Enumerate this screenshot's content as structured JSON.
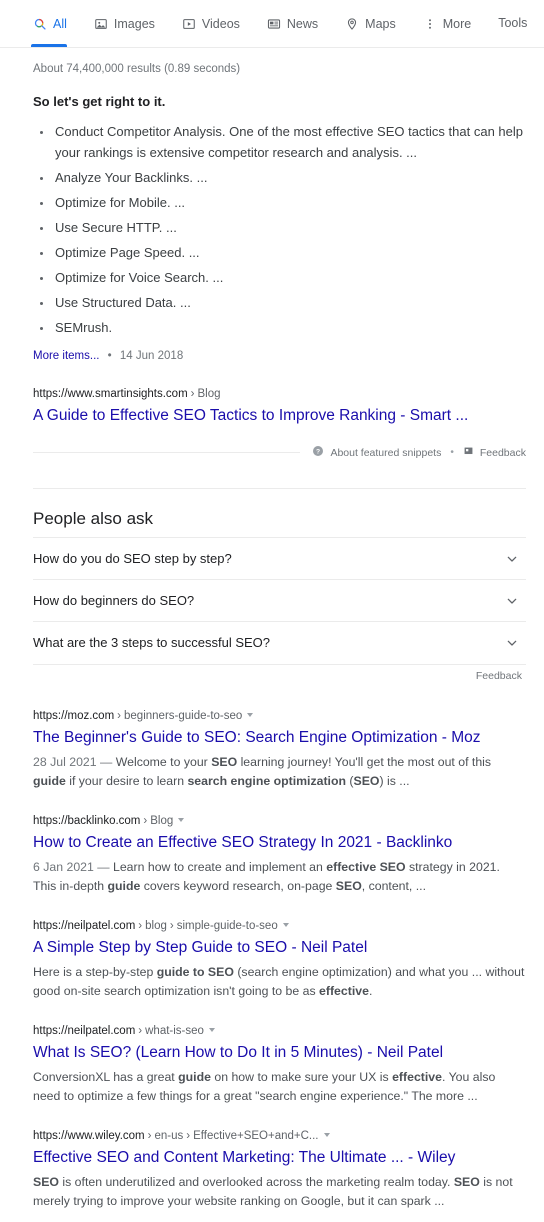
{
  "nav": {
    "items": [
      {
        "label": "All",
        "icon": "search-icon",
        "active": true
      },
      {
        "label": "Images",
        "icon": "image-icon",
        "active": false
      },
      {
        "label": "Videos",
        "icon": "video-icon",
        "active": false
      },
      {
        "label": "News",
        "icon": "news-icon",
        "active": false
      },
      {
        "label": "Maps",
        "icon": "map-pin-icon",
        "active": false
      },
      {
        "label": "More",
        "icon": "more-vertical-icon",
        "active": false
      }
    ],
    "tools_label": "Tools",
    "active_color": "#1a73e8",
    "inactive_color": "#5f6368"
  },
  "stats": "About 74,400,000 results (0.89 seconds)",
  "featured_snippet": {
    "heading": "So let's get right to it.",
    "bullets": [
      "Conduct Competitor Analysis. One of the most effective SEO tactics that can help your rankings is extensive competitor research and analysis. ...",
      "Analyze Your Backlinks. ...",
      "Optimize for Mobile. ...",
      "Use Secure HTTP. ...",
      "Optimize Page Speed. ...",
      "Optimize for Voice Search. ...",
      "Use Structured Data. ...",
      "SEMrush."
    ],
    "more_items_label": "More items...",
    "date": "14 Jun 2018",
    "source": {
      "domain": "https://www.smartinsights.com",
      "crumb": "Blog",
      "title": "A Guide to Effective SEO Tactics to Improve Ranking - Smart ..."
    },
    "footer": {
      "about_label": "About featured snippets",
      "about_icon": "help-circle-icon",
      "feedback_label": "Feedback",
      "feedback_icon": "flag-icon"
    }
  },
  "people_also_ask": {
    "title": "People also ask",
    "questions": [
      "How do you do SEO step by step?",
      "How do beginners do SEO?",
      "What are the 3 steps to successful SEO?"
    ],
    "expand_icon": "chevron-down-icon",
    "feedback_label": "Feedback"
  },
  "results": [
    {
      "domain": "https://moz.com",
      "crumbs": [
        "beginners-guide-to-seo"
      ],
      "title": "The Beginner's Guide to SEO: Search Engine Optimization - Moz",
      "date": "28 Jul 2021",
      "snippet_html": "Welcome to your <b>SEO</b> learning journey! You'll get the most out of this <b>guide</b> if your desire to learn <b>search engine optimization</b> (<b>SEO</b>) is ..."
    },
    {
      "domain": "https://backlinko.com",
      "crumbs": [
        "Blog"
      ],
      "title": "How to Create an Effective SEO Strategy In 2021 - Backlinko",
      "date": "6 Jan 2021",
      "snippet_html": "Learn how to create and implement an <b>effective SEO</b> strategy in 2021. This in-depth <b>guide</b> covers keyword research, on-page <b>SEO</b>, content, ..."
    },
    {
      "domain": "https://neilpatel.com",
      "crumbs": [
        "blog",
        "simple-guide-to-seo"
      ],
      "title": "A Simple Step by Step Guide to SEO - Neil Patel",
      "date": "",
      "snippet_html": "Here is a step-by-step <b>guide to SEO</b> (search engine optimization) and what you ... without good on-site search optimization isn't going to be as <b>effective</b>."
    },
    {
      "domain": "https://neilpatel.com",
      "crumbs": [
        "what-is-seo"
      ],
      "title": "What Is SEO? (Learn How to Do It in 5 Minutes) - Neil Patel",
      "date": "",
      "snippet_html": "ConversionXL has a great <b>guide</b> on how to make sure your UX is <b>effective</b>. You also need to optimize a few things for a great \"search engine experience.\" The more ..."
    },
    {
      "domain": "https://www.wiley.com",
      "crumbs": [
        "en-us",
        "Effective+SEO+and+C..."
      ],
      "title": "Effective SEO and Content Marketing: The Ultimate ... - Wiley",
      "date": "",
      "snippet_html": "<b>SEO</b> is often underutilized and overlooked across the marketing realm today. <b>SEO</b> is not merely trying to improve your website ranking on Google, but it can spark ..."
    }
  ],
  "colors": {
    "link": "#1a0dab",
    "url_text": "#202124",
    "snippet_text": "#4d5156",
    "muted": "#70757a",
    "divider": "#ebebeb"
  }
}
